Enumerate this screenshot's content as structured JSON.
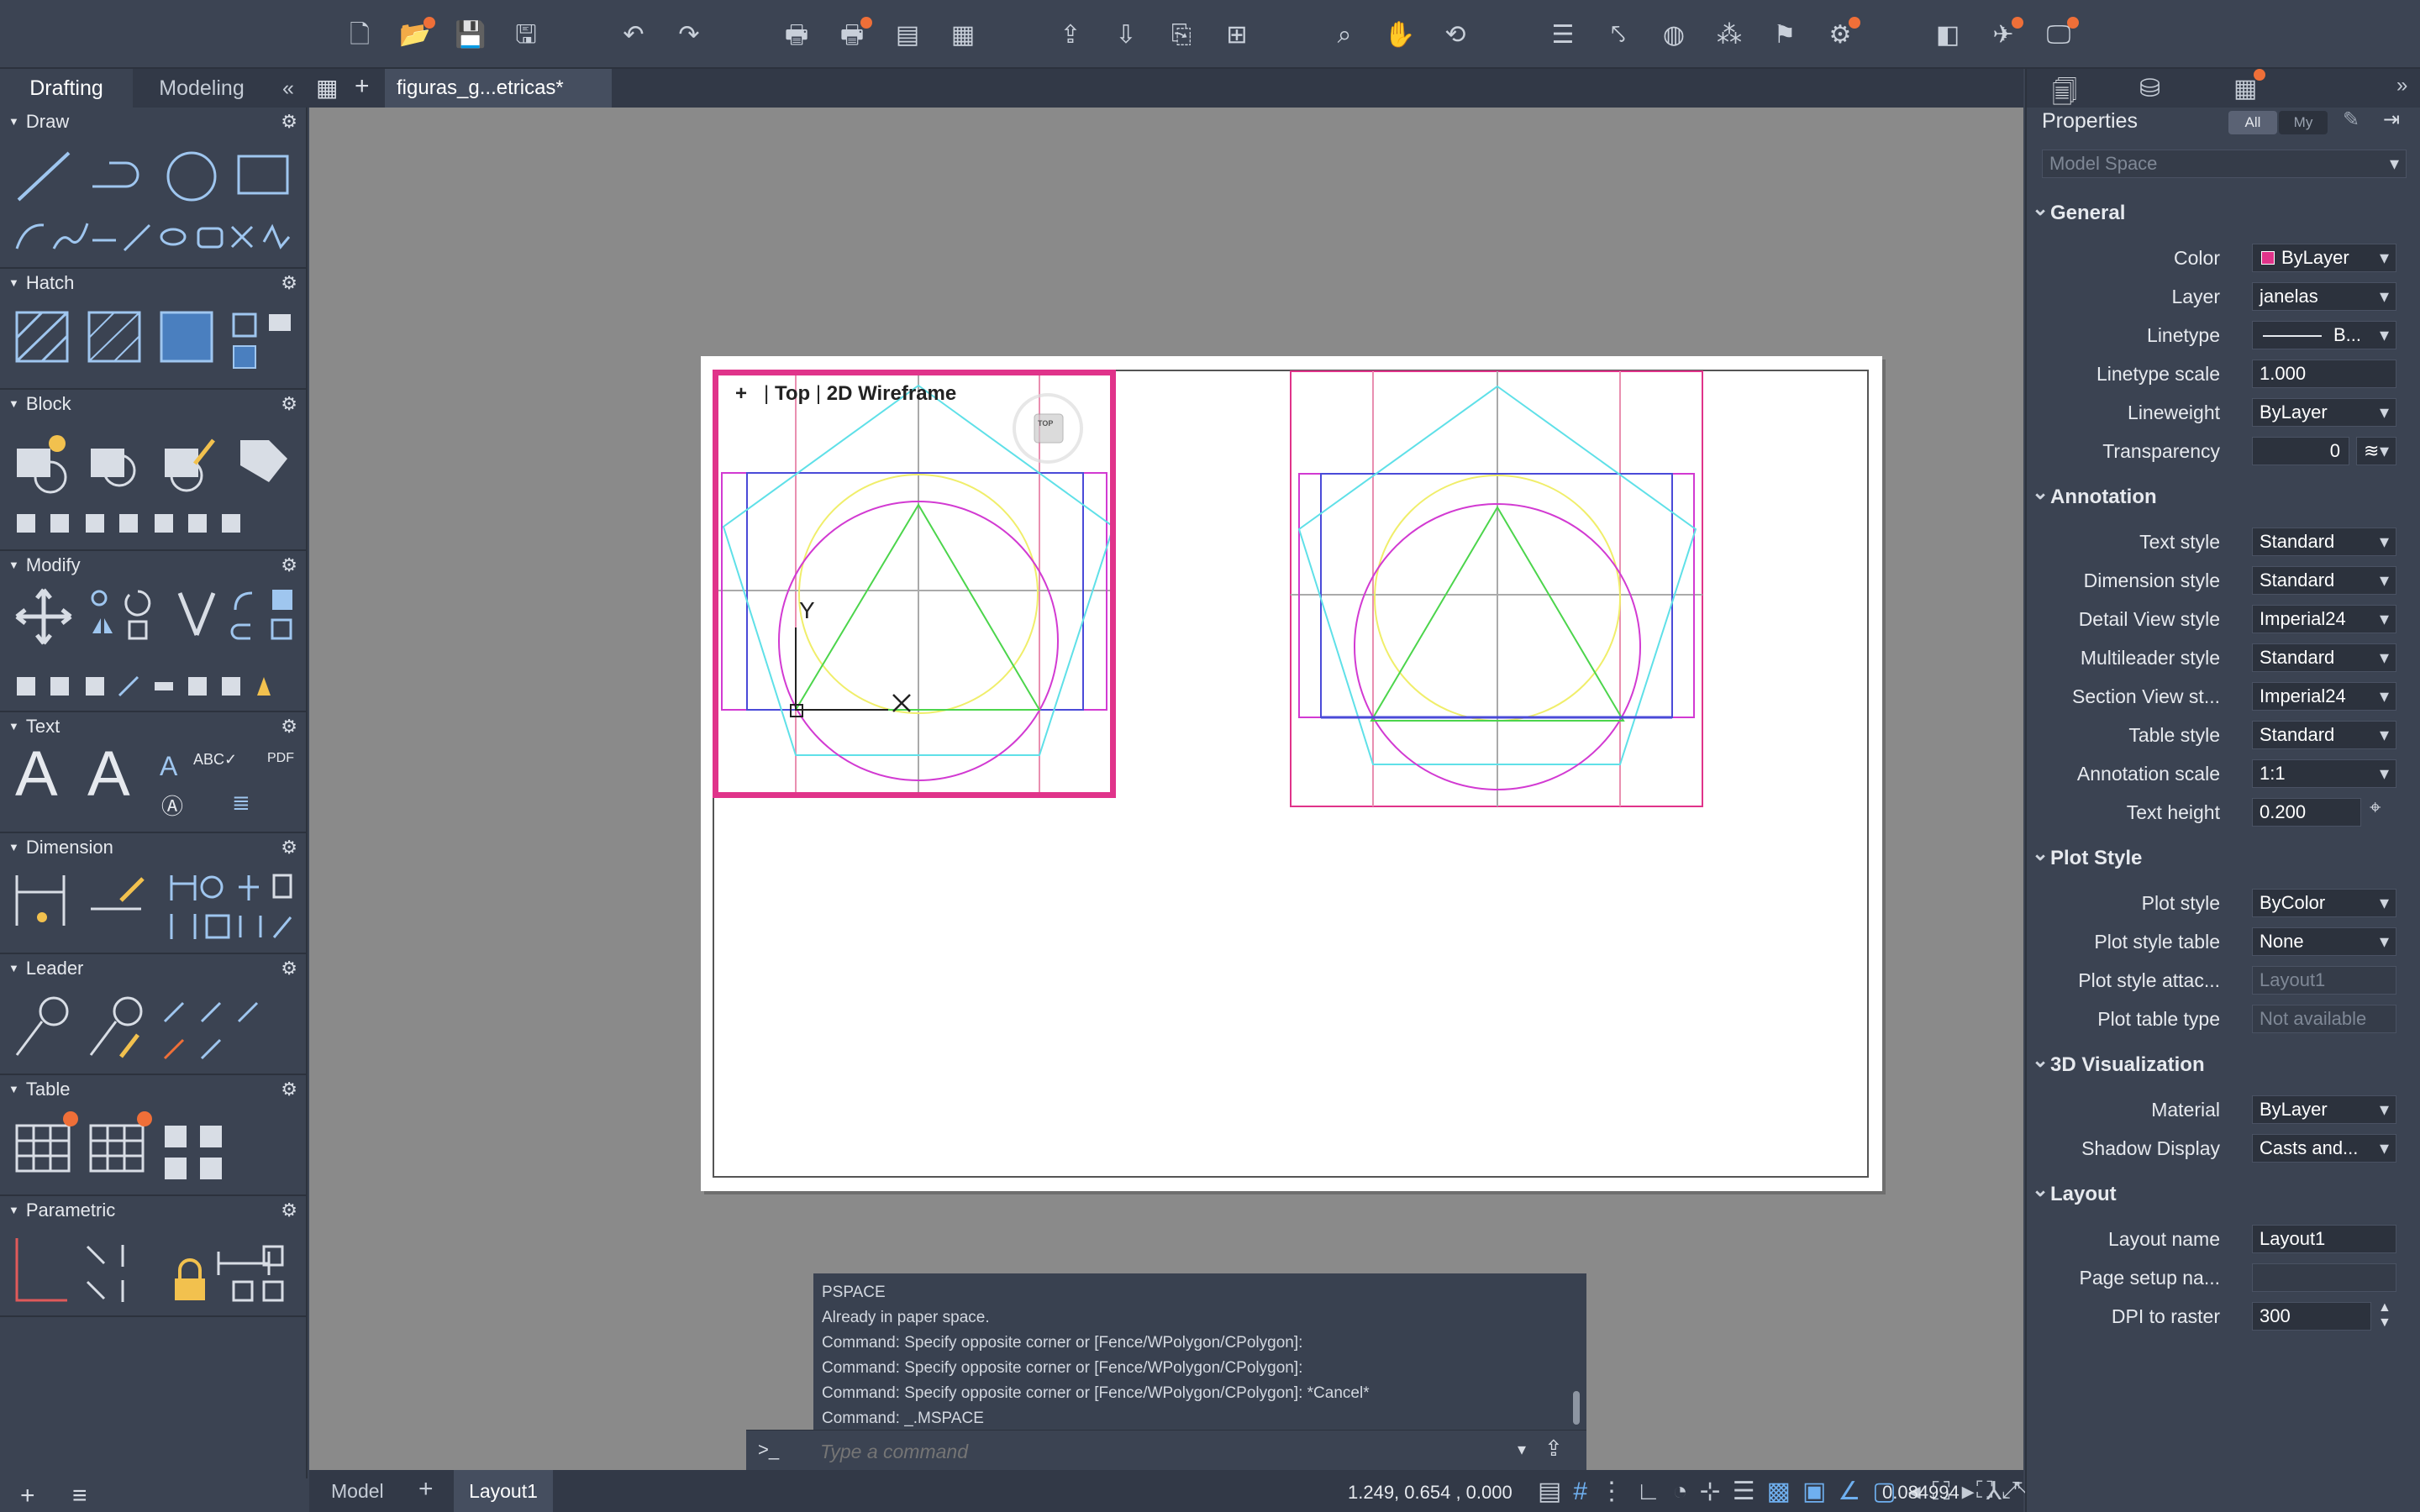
{
  "ribbon_tabs": {
    "drafting": "Drafting",
    "modeling": "Modeling"
  },
  "left_sections": {
    "draw": "Draw",
    "hatch": "Hatch",
    "block": "Block",
    "modify": "Modify",
    "text": "Text",
    "dimension": "Dimension",
    "leader": "Leader",
    "table": "Table",
    "parametric": "Parametric"
  },
  "document": {
    "tab_title": "figuras_g...etricas*"
  },
  "viewport": {
    "plus": "+",
    "view": "Top",
    "visual_style": "2D Wireframe",
    "cube_face": "TOP"
  },
  "ucs": {
    "y": "Y"
  },
  "command": {
    "history": [
      "PSPACE",
      "Already in paper space.",
      "Command: Specify opposite corner or [Fence/WPolygon/CPolygon]:",
      "Command: Specify opposite corner or [Fence/WPolygon/CPolygon]:",
      "Command: Specify opposite corner or [Fence/WPolygon/CPolygon]: *Cancel*",
      "Command: _.MSPACE"
    ],
    "prompt_symbol": ">_",
    "placeholder": "Type a command"
  },
  "status": {
    "model_tab": "Model",
    "layout_tab": "Layout1",
    "coordinates": "1.249,  0.654 , 0.000",
    "scale": "0.084994"
  },
  "properties": {
    "title": "Properties",
    "filter_all": "All",
    "filter_my": "My",
    "selection": "Model Space",
    "general": {
      "header": "General",
      "rows": [
        {
          "label": "Color",
          "value": "ByLayer"
        },
        {
          "label": "Layer",
          "value": "janelas"
        },
        {
          "label": "Linetype",
          "value": "B..."
        },
        {
          "label": "Linetype scale",
          "value": "1.000"
        },
        {
          "label": "Lineweight",
          "value": "ByLayer"
        },
        {
          "label": "Transparency",
          "value": "0"
        }
      ]
    },
    "annotation": {
      "header": "Annotation",
      "rows": [
        {
          "label": "Text style",
          "value": "Standard"
        },
        {
          "label": "Dimension style",
          "value": "Standard"
        },
        {
          "label": "Detail View style",
          "value": "Imperial24"
        },
        {
          "label": "Multileader style",
          "value": "Standard"
        },
        {
          "label": "Section View st...",
          "value": "Imperial24"
        },
        {
          "label": "Table style",
          "value": "Standard"
        },
        {
          "label": "Annotation scale",
          "value": "1:1"
        },
        {
          "label": "Text height",
          "value": "0.200"
        }
      ]
    },
    "plot_style": {
      "header": "Plot Style",
      "rows": [
        {
          "label": "Plot style",
          "value": "ByColor"
        },
        {
          "label": "Plot style table",
          "value": "None"
        },
        {
          "label": "Plot style attac...",
          "value": "Layout1"
        },
        {
          "label": "Plot table type",
          "value": "Not available"
        }
      ]
    },
    "visualization": {
      "header": "3D Visualization",
      "rows": [
        {
          "label": "Material",
          "value": "ByLayer"
        },
        {
          "label": "Shadow Display",
          "value": "Casts and..."
        }
      ]
    },
    "layout": {
      "header": "Layout",
      "rows": [
        {
          "label": "Layout name",
          "value": "Layout1"
        },
        {
          "label": "Page setup na...",
          "value": ""
        },
        {
          "label": "DPI to raster",
          "value": "300"
        }
      ]
    }
  },
  "colors": {
    "viewport_border": "#e0338a",
    "accent": "#ef6f38",
    "magenta": "#d23ad2",
    "cyan": "#5fe0e8",
    "yellow": "#f0ee6a",
    "green": "#4cd54c",
    "blue": "#4a4ad8"
  }
}
